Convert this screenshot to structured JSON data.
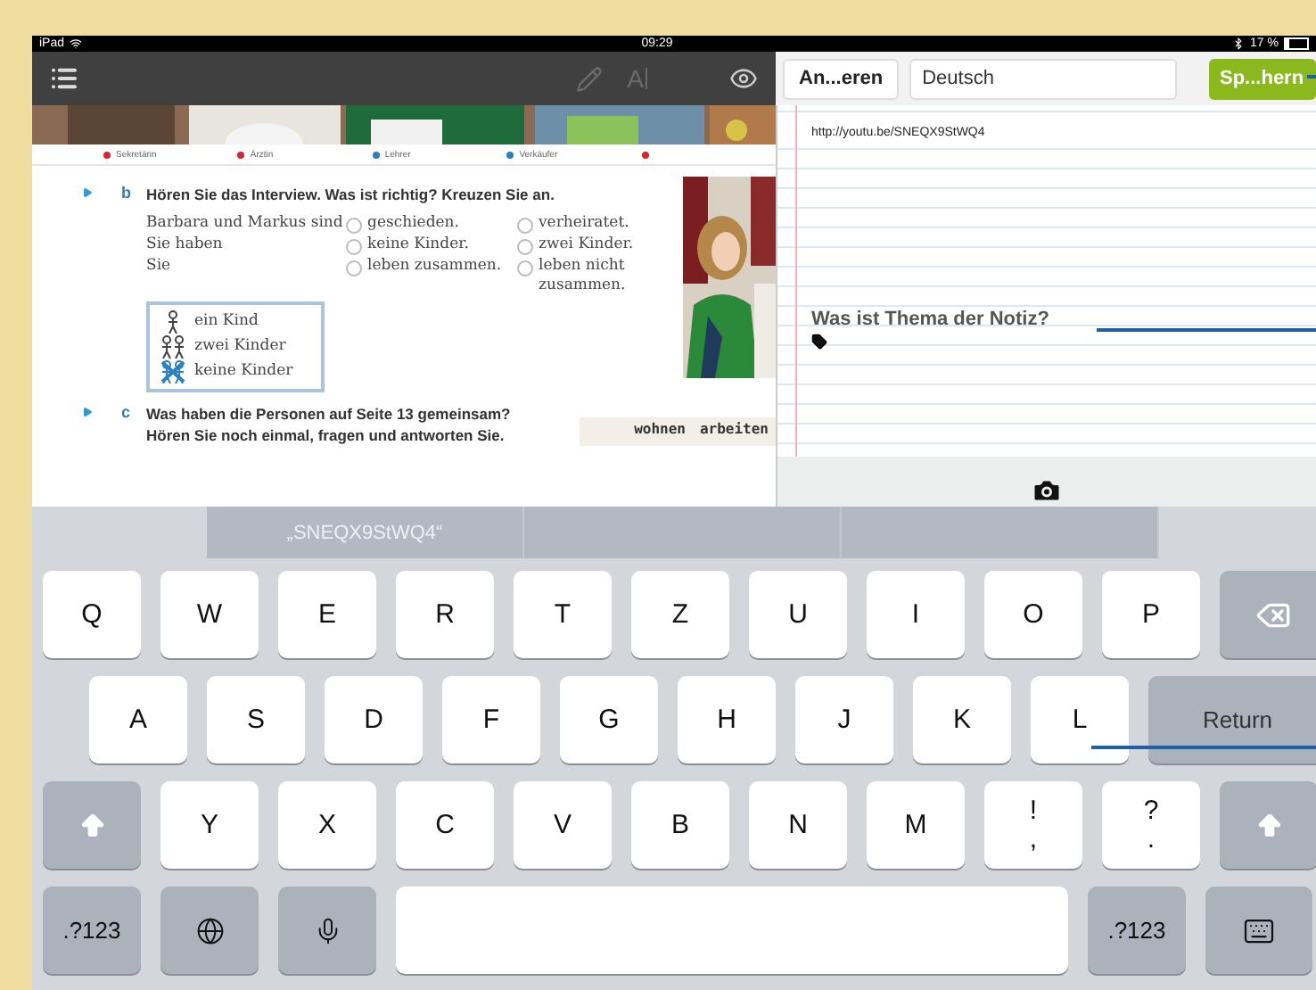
{
  "status_bar": {
    "device": "iPad",
    "time": "09:29",
    "battery": "17 %"
  },
  "toolbar": {
    "text_tool": "A"
  },
  "notes_header": {
    "cancel_button": "An...eren",
    "language_field": "Deutsch",
    "save_button": "Sp...hern"
  },
  "textbook": {
    "captions": [
      {
        "label": "Sekretärin",
        "color": "#d8242c"
      },
      {
        "label": "Ärztin",
        "color": "#d8242c"
      },
      {
        "label": "Lehrer",
        "color": "#2a7fc0"
      },
      {
        "label": "Verkäufer",
        "color": "#2a7fc0"
      },
      {
        "color": "#d8242c"
      }
    ],
    "exercise_b": {
      "letter": "b",
      "instruction": "Hören Sie das Interview. Was ist richtig? Kreuzen Sie an.",
      "statements": [
        {
          "subject": "Barbara und Markus sind",
          "options": [
            {
              "label": "geschieden.",
              "checked": false
            },
            {
              "label": "verheiratet.",
              "checked": false
            }
          ]
        },
        {
          "subject": "Sie haben",
          "options": [
            {
              "label": "keine Kinder.",
              "checked": false
            },
            {
              "label": "zwei Kinder.",
              "checked": false
            }
          ]
        },
        {
          "subject": "Sie",
          "options": [
            {
              "label": "leben zusammen.",
              "checked": false
            },
            {
              "label": "leben nicht zusammen.",
              "checked": false
            }
          ]
        }
      ],
      "legend": [
        {
          "kind": "one",
          "label": "ein Kind"
        },
        {
          "kind": "two",
          "label": "zwei Kinder"
        },
        {
          "kind": "none",
          "label": "keine Kinder"
        }
      ]
    },
    "exercise_c": {
      "letter": "c",
      "instruction": "Was haben die Personen auf Seite 13 gemeinsam? Hören Sie noch einmal, fragen und antworten Sie.",
      "table_header": [
        "wohnen",
        "arbeiten"
      ]
    }
  },
  "notes": {
    "link": "http://youtu.be/SNEQX9StWQ4",
    "prompt": "Was ist Thema der Notiz?"
  },
  "keyboard": {
    "suggestions": [
      "„SNEQX9StWQ4“"
    ],
    "key_rows": [
      {
        "keys": [
          {
            "kind": "letter",
            "label": "Q"
          },
          {
            "kind": "letter",
            "label": "W"
          },
          {
            "kind": "letter",
            "label": "E"
          },
          {
            "kind": "letter",
            "label": "R"
          },
          {
            "kind": "letter",
            "label": "T"
          },
          {
            "kind": "letter",
            "label": "Z"
          },
          {
            "kind": "letter",
            "label": "U"
          },
          {
            "kind": "letter",
            "label": "I"
          },
          {
            "kind": "letter",
            "label": "O"
          },
          {
            "kind": "letter",
            "label": "P"
          },
          {
            "kind": "delete"
          }
        ]
      },
      {
        "keys": [
          {
            "kind": "letter",
            "label": "A"
          },
          {
            "kind": "letter",
            "label": "S"
          },
          {
            "kind": "letter",
            "label": "D"
          },
          {
            "kind": "letter",
            "label": "F"
          },
          {
            "kind": "letter",
            "label": "G"
          },
          {
            "kind": "letter",
            "label": "H"
          },
          {
            "kind": "letter",
            "label": "J"
          },
          {
            "kind": "letter",
            "label": "K"
          },
          {
            "kind": "letter",
            "label": "L"
          },
          {
            "kind": "return",
            "label": "Return"
          }
        ]
      },
      {
        "keys": [
          {
            "kind": "shift"
          },
          {
            "kind": "letter",
            "label": "Y"
          },
          {
            "kind": "letter",
            "label": "X"
          },
          {
            "kind": "letter",
            "label": "C"
          },
          {
            "kind": "letter",
            "label": "V"
          },
          {
            "kind": "letter",
            "label": "B"
          },
          {
            "kind": "letter",
            "label": "N"
          },
          {
            "kind": "letter",
            "label": "M"
          },
          {
            "kind": "punct",
            "label": "!",
            "sub": ","
          },
          {
            "kind": "punct",
            "label": "?",
            "sub": "."
          },
          {
            "kind": "shift"
          }
        ]
      },
      {
        "keys": [
          {
            "kind": "mode",
            "label": ".?123"
          },
          {
            "kind": "globe"
          },
          {
            "kind": "mic"
          },
          {
            "kind": "space"
          },
          {
            "kind": "mode",
            "label": ".?123"
          },
          {
            "kind": "hide"
          }
        ]
      }
    ]
  }
}
